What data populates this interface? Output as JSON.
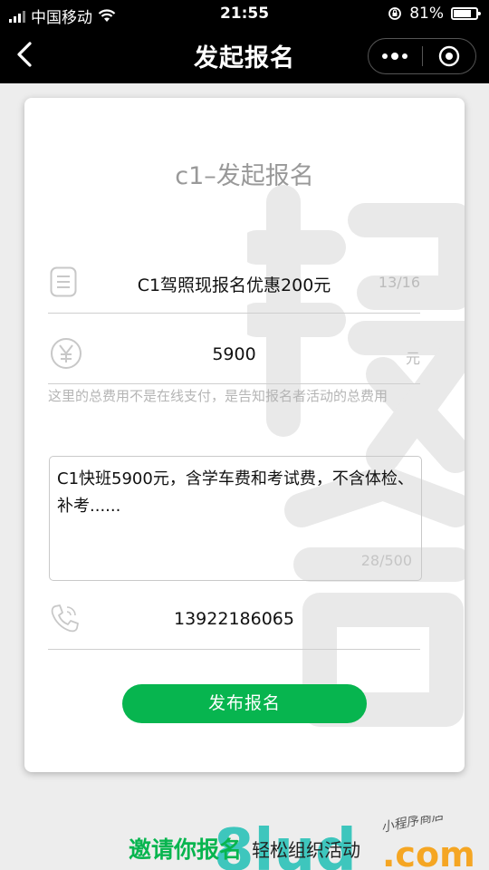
{
  "status_bar": {
    "carrier": "中国移动",
    "time": "21:55",
    "battery": "81%",
    "battery_level": 0.81
  },
  "nav": {
    "title": "发起报名"
  },
  "form": {
    "heading": "c1–发起报名",
    "title_value": "C1驾照现报名优惠200元",
    "title_counter": "13/16",
    "fee_value": "5900",
    "fee_unit": "元",
    "fee_hint": "这里的总费用不是在线支付，是告知报名者活动的总费用",
    "description": "C1快班5900元，含学车费和考试费，不含体检、补考......",
    "description_counter": "28/500",
    "phone": "13922186065",
    "submit_label": "发布报名"
  },
  "footer": {
    "slogan_green": "邀请你报名",
    "slogan_black": "轻松组织活动",
    "logo_text": "8lud.com",
    "logo_sub": "小程序商店"
  },
  "colors": {
    "accent": "#07b54f",
    "nav_bg": "#000000",
    "page_bg": "#ededed"
  },
  "icons": {
    "back": "chevron-left-icon",
    "more": "more-dots-icon",
    "close": "target-icon",
    "title_field": "document-icon",
    "fee_field": "yuan-icon",
    "phone_field": "phone-icon",
    "wifi": "wifi-icon",
    "signal": "signal-icon",
    "lock": "rotation-lock-icon",
    "battery": "battery-icon"
  }
}
